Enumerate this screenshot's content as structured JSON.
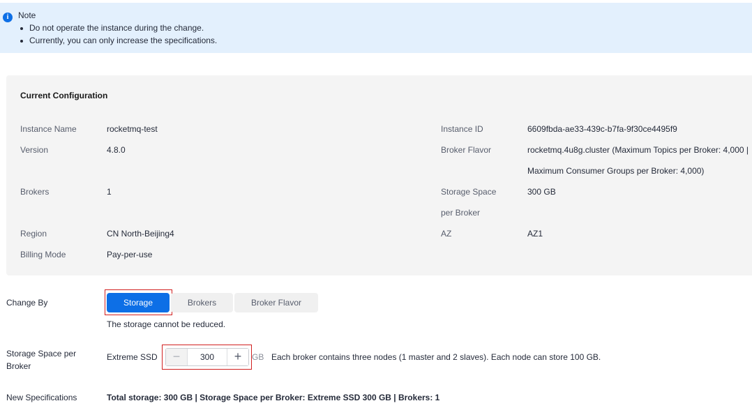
{
  "notice": {
    "title": "Note",
    "items": [
      "Do not operate the instance during the change.",
      "Currently, you can only increase the specifications."
    ]
  },
  "current_config": {
    "title": "Current Configuration",
    "instance_name": {
      "label": "Instance Name",
      "value": "rocketmq-test"
    },
    "version": {
      "label": "Version",
      "value": "4.8.0"
    },
    "brokers": {
      "label": "Brokers",
      "value": "1"
    },
    "region": {
      "label": "Region",
      "value": "CN North-Beijing4"
    },
    "billing_mode": {
      "label": "Billing Mode",
      "value": "Pay-per-use"
    },
    "instance_id": {
      "label": "Instance ID",
      "value": "6609fbda-ae33-439c-b7fa-9f30ce4495f9"
    },
    "broker_flavor": {
      "label": "Broker Flavor",
      "value_line1": "rocketmq.4u8g.cluster (Maximum Topics per Broker: 4,000 |",
      "value_line2": "Maximum Consumer Groups per Broker: 4,000)"
    },
    "storage_space": {
      "label_line1": "Storage Space",
      "label_line2": "per Broker",
      "value": "300 GB"
    },
    "az": {
      "label": "AZ",
      "value": "AZ1"
    }
  },
  "change_by": {
    "label": "Change By",
    "tabs": [
      "Storage",
      "Brokers",
      "Broker Flavor"
    ],
    "active": "Storage",
    "hint": "The storage cannot be reduced."
  },
  "storage": {
    "label_line1": "Storage Space per",
    "label_line2": "Broker",
    "disk_type": "Extreme SSD",
    "value": "300",
    "unit": "GB",
    "description": "Each broker contains three nodes (1 master and 2 slaves). Each node can store 100 GB."
  },
  "new_specs": {
    "label": "New Specifications",
    "value": "Total storage: 300 GB | Storage Space per Broker: Extreme SSD 300 GB | Brokers: 1"
  },
  "colors": {
    "primary": "#0d6fe6",
    "highlight": "#d11f1f",
    "notice_bg": "#e3f0fd"
  }
}
